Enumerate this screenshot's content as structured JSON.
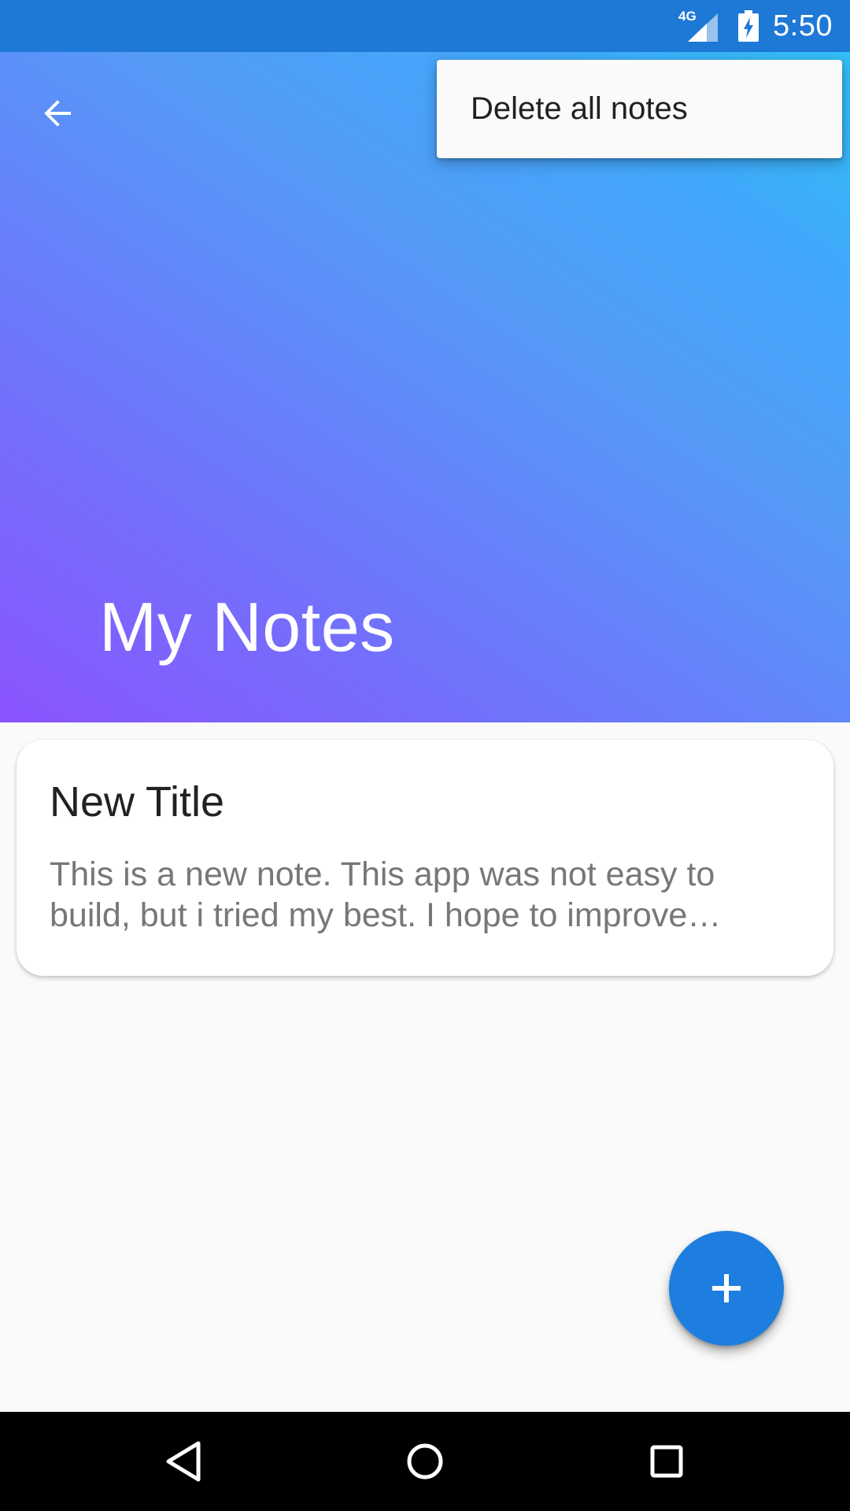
{
  "status_bar": {
    "network_label": "4G",
    "time": "5:50",
    "icons": [
      "signal-icon",
      "battery-charging-icon"
    ]
  },
  "header": {
    "title": "My Notes",
    "back_icon": "arrow-back-icon",
    "gradient_colors": [
      "#8b54ff",
      "#549bf7",
      "#33bff6"
    ]
  },
  "menu": {
    "items": [
      {
        "label": "Delete all notes"
      }
    ]
  },
  "notes": [
    {
      "title": "New Title",
      "body": "This is a new note. This app was not easy to build, but i tried my best. I hope to improve…"
    }
  ],
  "fab": {
    "icon": "add-icon",
    "color": "#1e7ee0"
  },
  "nav_bar": {
    "icons": [
      "back-triangle-icon",
      "home-circle-icon",
      "recents-square-icon"
    ]
  },
  "colors": {
    "status_bar": "#1e78d6",
    "background": "#fafafa"
  }
}
